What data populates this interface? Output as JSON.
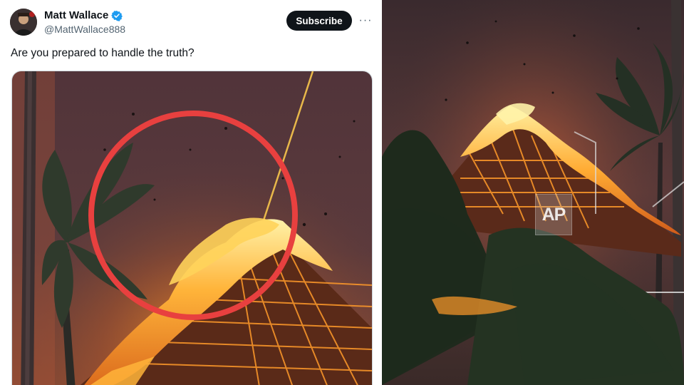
{
  "post": {
    "author": {
      "name": "Matt Wallace",
      "handle": "@MattWallace888",
      "verified": true
    },
    "subscribe_label": "Subscribe",
    "more_label": "···",
    "text": "Are you prepared to handle the truth?",
    "image_annotation_color": "#e8403f"
  },
  "news_photo": {
    "watermark": "AP"
  },
  "colors": {
    "text_primary": "#0f1419",
    "text_secondary": "#536471",
    "verified_blue": "#1d9bf0",
    "button_dark": "#0f1419",
    "fire_orange": "#ff9a1f",
    "smoke_purple": "#4a3238"
  },
  "icons": {
    "verified": "verified-check-icon",
    "more": "more-options-icon"
  }
}
